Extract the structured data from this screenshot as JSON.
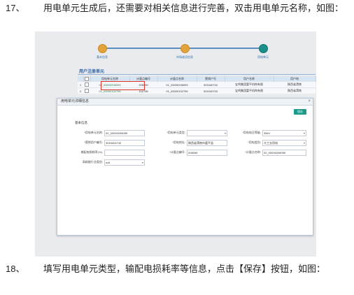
{
  "step17": {
    "num": "17、",
    "text": "用电单元生成后，还需要对相关信息进行完善，双击用电单元名称，如图："
  },
  "step18": {
    "num": "18、",
    "text": "填写用电单元类型，输配电损耗率等信息，点击【保存】按钮，如图："
  },
  "screenshot": {
    "progress": [
      {
        "label": "基本信息"
      },
      {
        "label": "市场成员信息"
      },
      {
        "label": "用电单元"
      }
    ],
    "panel_title": "用户注册单元",
    "table": {
      "headers": [
        "",
        "",
        "用电单元名称",
        "计量点编号",
        "计量点名称",
        "营销户号",
        "用户名称",
        "用户地"
      ],
      "rows": [
        [
          "1",
          "",
          "02_00000208059",
          "208059",
          "01_00000208059",
          "301540740",
          "宝鸡集团富平机构有限",
          "陕西省渭南"
        ],
        [
          "2",
          "",
          "01_00000102755",
          "102755",
          "01_00000102755",
          "301540740",
          "宝鸡集团富平机构有限",
          "陕西省渭南"
        ]
      ]
    },
    "dialog": {
      "title": "用电单元详细信息",
      "close_icon": "×",
      "save_label": "保存",
      "section": "基本信息",
      "fields": {
        "unit_name_label": "*用电单元名称:",
        "unit_name_value": "02_00000208059",
        "unit_type_label": "*用电单元类型:",
        "unit_type_value": "",
        "voltage_label": "*用电电压等级:",
        "voltage_value": "35kV",
        "account_label": "*营销用户编号:",
        "account_value": "3015404740",
        "address_label": "*用电地址:",
        "address_value": "陕西省渭南市富平县",
        "usage_label": "*用电类别:",
        "usage_value": "大工业用电",
        "loss_label": "输配电损耗率(%):",
        "loss_value": "",
        "meter_no_label": "*计量点编号:",
        "meter_no_value": "208059",
        "meter_name_label": "*计量点名称:",
        "meter_name_value": "02_00000208059",
        "industry_label": "高耗能行业类别:",
        "industry_value": "null"
      }
    }
  }
}
